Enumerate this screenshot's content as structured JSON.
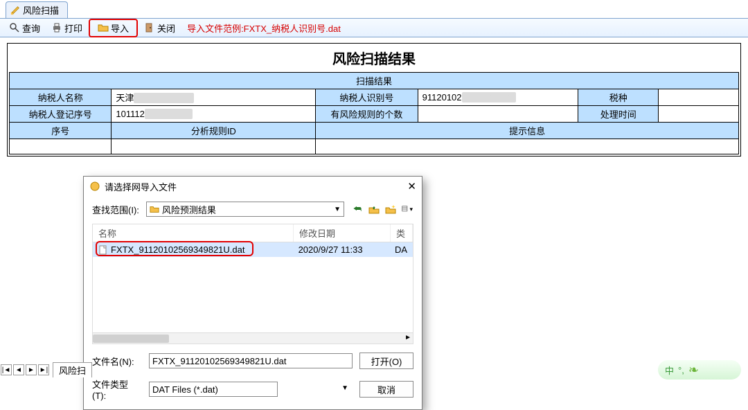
{
  "tab": {
    "label": "风险扫描"
  },
  "toolbar": {
    "query": "查询",
    "print": "打印",
    "import": "导入",
    "close": "关闭",
    "hint": "导入文件范例:FXTX_纳税人识别号.dat"
  },
  "result": {
    "title": "风险扫描结果",
    "band": "扫描结果",
    "labels": {
      "taxpayer_name": "纳税人名称",
      "taxpayer_id": "纳税人识别号",
      "tax_type": "税种",
      "reg_seq": "纳税人登记序号",
      "risk_count": "有风险规则的个数",
      "proc_time": "处理时间",
      "seq": "序号",
      "rule_id": "分析规则ID",
      "tip": "提示信息"
    },
    "values": {
      "taxpayer_name": "天津",
      "taxpayer_name_blur": "XXXXXXXXXX",
      "taxpayer_id": "91120102",
      "taxpayer_id_blur": "XXXXXXXXX",
      "tax_type": "",
      "reg_seq": "101112",
      "reg_seq_blur": "XXXXXXXX",
      "risk_count": "",
      "proc_time": ""
    }
  },
  "sheet": {
    "label": "风险扫"
  },
  "status": {
    "text": "中"
  },
  "dialog": {
    "title": "请选择网导入文件",
    "look_in_label": "查找范围(I):",
    "look_in_value": "风险预测结果",
    "cols": {
      "name": "名称",
      "date": "修改日期",
      "type": "类"
    },
    "file": {
      "name": "FXTX_91120102569349821U.dat",
      "date": "2020/9/27 11:33",
      "type": "DA"
    },
    "file_name_label": "文件名(N):",
    "file_name_value": "FXTX_91120102569349821U.dat",
    "file_type_label": "文件类型(T):",
    "file_type_value": "DAT Files (*.dat)",
    "open": "打开(O)",
    "cancel": "取消"
  }
}
